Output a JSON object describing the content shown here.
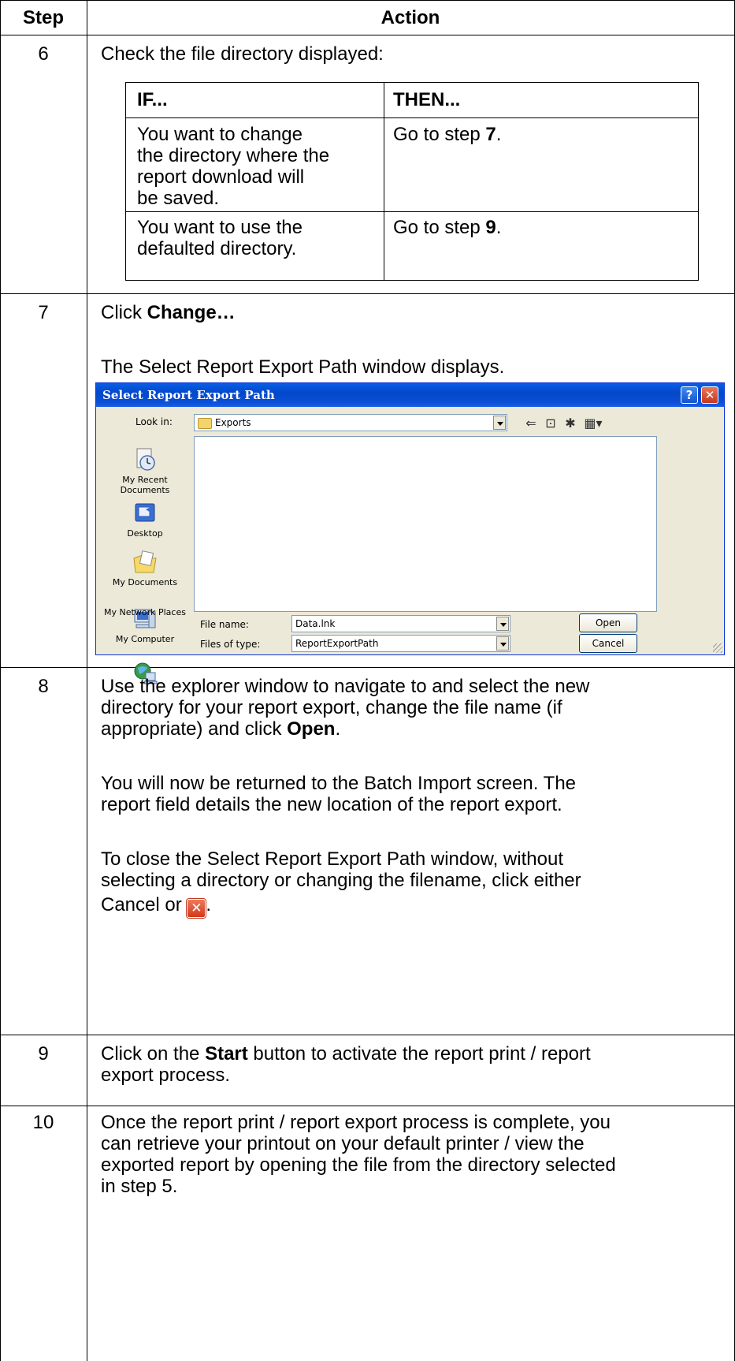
{
  "table": {
    "header": {
      "step": "Step",
      "action": "Action"
    },
    "rows": [
      {
        "step": "6",
        "intro": "Check the file directory displayed:",
        "nested": {
          "col_if": "IF...",
          "col_then": "THEN...",
          "r1_if": [
            "You want to change",
            "the directory where the",
            "report download will",
            "be saved."
          ],
          "r1_then_prefix": "Go to step ",
          "r1_then_step": "7",
          "r1_then_suffix": ".",
          "r2_if": [
            "You want to use the",
            "defaulted directory."
          ],
          "r2_then_prefix": "Go to step ",
          "r2_then_step": "9",
          "r2_then_suffix": "."
        }
      },
      {
        "step": "7",
        "click_prefix": "Click ",
        "click_bold": "Change…",
        "note": "The Select Report Export Path window displays."
      },
      {
        "step": "8",
        "p1": [
          "Use the explorer window to navigate to and select the new",
          "directory for your report export, change the file name (if",
          "appropriate) and click "
        ],
        "p1_bold": "Open",
        "p1_end": ".",
        "p2": [
          "You will now be returned to the Batch Import screen. The",
          "report field details the new location of the report export."
        ],
        "p3": [
          "To close the Select Report Export Path window, without",
          "selecting a directory or changing the filename, click either"
        ],
        "p3_last": "Cancel or ",
        "p3_end": "."
      },
      {
        "step": "9",
        "l1_prefix": "Click on the ",
        "l1_bold": "Start",
        "l1_suffix": " button to activate the report print / report",
        "l2": "export process."
      },
      {
        "step": "10",
        "lines": [
          "Once the report print / report export process is complete, you",
          "can retrieve your printout on your default printer / view the",
          "exported report by opening the file from the directory selected",
          "in step 5."
        ]
      }
    ]
  },
  "dialog": {
    "title": "Select Report Export Path",
    "help": "?",
    "look_in_label": "Look in:",
    "look_in_value": "Exports",
    "places": [
      {
        "label": "My Recent Documents",
        "icon": "recent-documents-icon"
      },
      {
        "label": "Desktop",
        "icon": "desktop-icon"
      },
      {
        "label": "My Documents",
        "icon": "my-documents-icon"
      },
      {
        "label": "My Computer",
        "icon": "my-computer-icon"
      },
      {
        "label": "My Network Places",
        "icon": "network-places-icon"
      }
    ],
    "file_name_label": "File name:",
    "file_name_value": "Data.lnk",
    "files_of_type_label": "Files of type:",
    "files_of_type_value": "ReportExportPath",
    "open_label": "Open",
    "cancel_label": "Cancel",
    "colors": {
      "titlebar": "#0348c9",
      "face": "#ece9d8",
      "close": "#c5381e"
    }
  }
}
